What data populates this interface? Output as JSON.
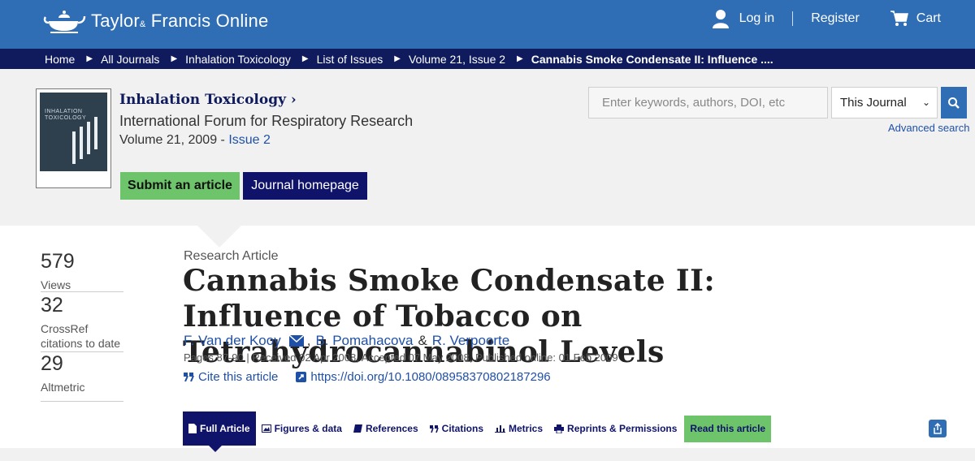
{
  "header": {
    "logo_text_1": "Taylor",
    "logo_amp": "&",
    "logo_text_2": "Francis Online",
    "login": "Log in",
    "register": "Register",
    "cart": "Cart"
  },
  "breadcrumb": [
    "Home",
    "All Journals",
    "Inhalation Toxicology",
    "List of Issues",
    "Volume 21, Issue 2",
    "Cannabis Smoke Condensate II: Influence ...."
  ],
  "journal": {
    "title": "Inhalation Toxicology",
    "subtitle": "International Forum for Respiratory Research",
    "volume": "Volume 21, 2009 - ",
    "issue": "Issue 2",
    "cover_text": "INHALATION TOXICOLOGY",
    "submit": "Submit an article",
    "homepage": "Journal homepage"
  },
  "search": {
    "placeholder": "Enter keywords, authors, DOI, etc",
    "scope": "This Journal",
    "advanced": "Advanced search"
  },
  "stats": [
    {
      "value": "579",
      "label": "Views"
    },
    {
      "value": "32",
      "label": "CrossRef citations to date"
    },
    {
      "value": "29",
      "label": "Altmetric"
    }
  ],
  "article": {
    "type": "Research Article",
    "title": "Cannabis Smoke Condensate II: Influence of Tobacco on Tetrahydrocannabinol Levels",
    "authors": [
      "F. Van der Kooy",
      "B. Pomahacova",
      "R. Verpoorte"
    ],
    "author_sep_1": ",",
    "author_sep_2": "&",
    "pages_info": "Pages 87-90 | Received 02 Apr 2008, Accepted 07 May 2008, Published online: 01 Feb 2009",
    "cite": "Cite this article",
    "doi": "https://doi.org/10.1080/08958370802187296"
  },
  "tabs": {
    "full": "Full Article",
    "figures": "Figures & data",
    "references": "References",
    "citations": "Citations",
    "metrics": "Metrics",
    "reprints": "Reprints & Permissions",
    "read": "Read this article"
  },
  "colors": {
    "topbar": "#2f6db5",
    "breadcrumb": "#0f1b5c",
    "green": "#6ec46a",
    "navy": "#10136a"
  }
}
